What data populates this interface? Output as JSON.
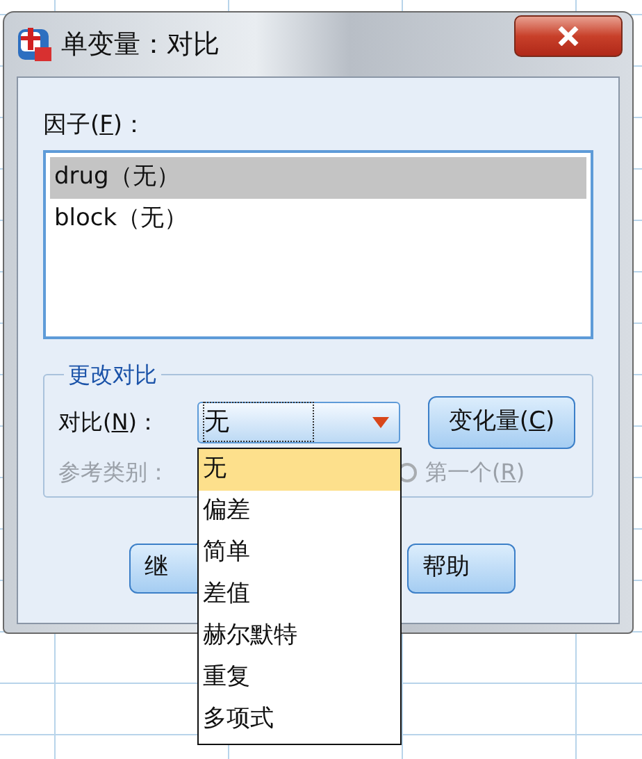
{
  "window": {
    "title": "单变量：对比"
  },
  "factors": {
    "label": {
      "before": "因子(",
      "mnemonic": "F",
      "after": ")："
    },
    "items": [
      {
        "text": "drug（无）",
        "selected": true
      },
      {
        "text": "block（无）",
        "selected": false
      }
    ]
  },
  "change_contrast": {
    "title": "更改对比",
    "contrast_label": {
      "before": "对比(",
      "mnemonic": "N",
      "after": ")："
    },
    "contrast_value": "无",
    "change_button": {
      "before": "变化量(",
      "mnemonic": "C",
      "after": ")"
    },
    "reference_label": "参考类别：",
    "reference_option": {
      "before": "第一个(",
      "mnemonic": "R",
      "after": ")",
      "selected": false,
      "disabled": true
    }
  },
  "buttons": [
    {
      "text": "继"
    },
    {
      "text": "帮助"
    }
  ],
  "dropdown": {
    "options": [
      {
        "text": "无",
        "selected": true
      },
      {
        "text": "偏差",
        "selected": false
      },
      {
        "text": "简单",
        "selected": false
      },
      {
        "text": "差值",
        "selected": false
      },
      {
        "text": "赫尔默特",
        "selected": false
      },
      {
        "text": "重复",
        "selected": false
      },
      {
        "text": "多项式",
        "selected": false
      }
    ]
  }
}
